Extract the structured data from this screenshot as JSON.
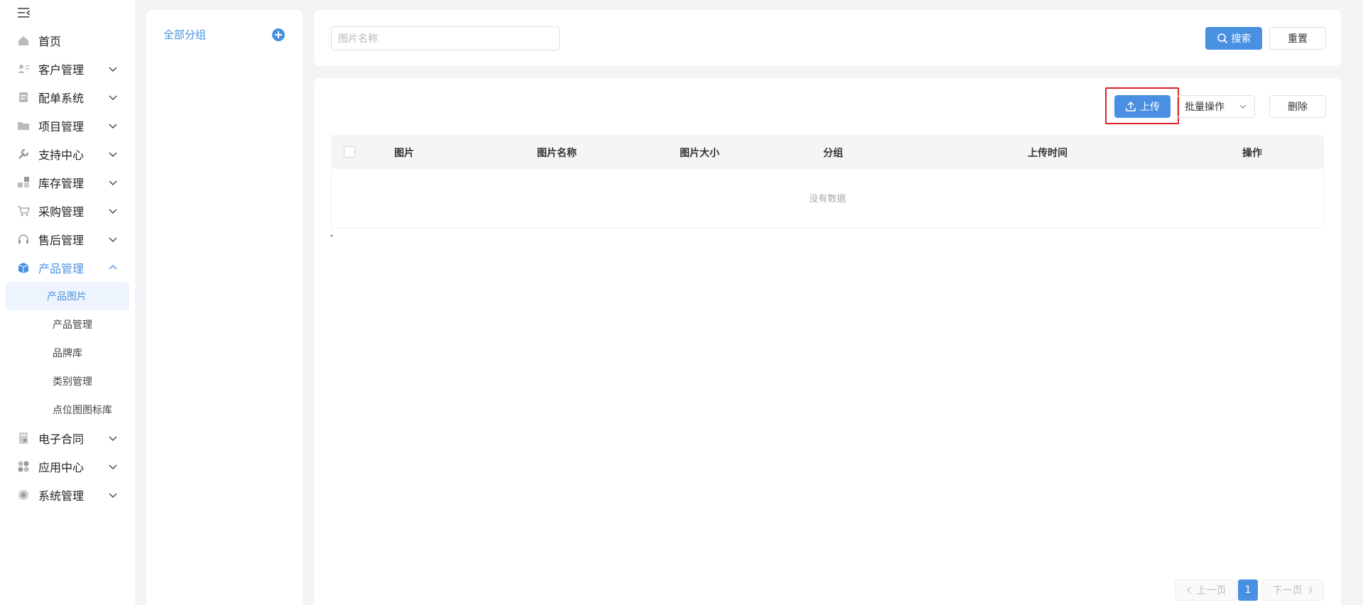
{
  "sidebar": {
    "items": [
      {
        "label": "首页",
        "icon": "home-icon",
        "has_chevron": false
      },
      {
        "label": "客户管理",
        "icon": "customer-icon",
        "has_chevron": true
      },
      {
        "label": "配单系统",
        "icon": "order-icon",
        "has_chevron": true
      },
      {
        "label": "项目管理",
        "icon": "folder-icon",
        "has_chevron": true
      },
      {
        "label": "支持中心",
        "icon": "wrench-icon",
        "has_chevron": true
      },
      {
        "label": "库存管理",
        "icon": "inventory-icon",
        "has_chevron": true
      },
      {
        "label": "采购管理",
        "icon": "cart-icon",
        "has_chevron": true
      },
      {
        "label": "售后管理",
        "icon": "headset-icon",
        "has_chevron": true
      },
      {
        "label": "产品管理",
        "icon": "product-box-icon",
        "has_chevron": true,
        "expanded": true
      },
      {
        "label": "电子合同",
        "icon": "contract-icon",
        "has_chevron": true
      },
      {
        "label": "应用中心",
        "icon": "apps-icon",
        "has_chevron": true
      },
      {
        "label": "系统管理",
        "icon": "settings-icon",
        "has_chevron": true
      }
    ],
    "product_subitems": [
      "产品图片",
      "产品管理",
      "品牌库",
      "类别管理",
      "点位图图标库"
    ],
    "active_subitem": "产品图片"
  },
  "groups": {
    "all_label": "全部分组"
  },
  "search": {
    "placeholder": "图片名称",
    "search_label": "搜索",
    "reset_label": "重置"
  },
  "toolbar": {
    "upload_label": "上传",
    "batch_label": "批量操作",
    "delete_label": "删除"
  },
  "table": {
    "columns": [
      "图片",
      "图片名称",
      "图片大小",
      "分组",
      "上传时间",
      "操作"
    ],
    "empty_text": "没有数据"
  },
  "pagination": {
    "prev_label": "上一页",
    "current_page": "1",
    "next_label": "下一页"
  },
  "colors": {
    "primary": "#4a90e2",
    "highlight": "#e02020"
  }
}
